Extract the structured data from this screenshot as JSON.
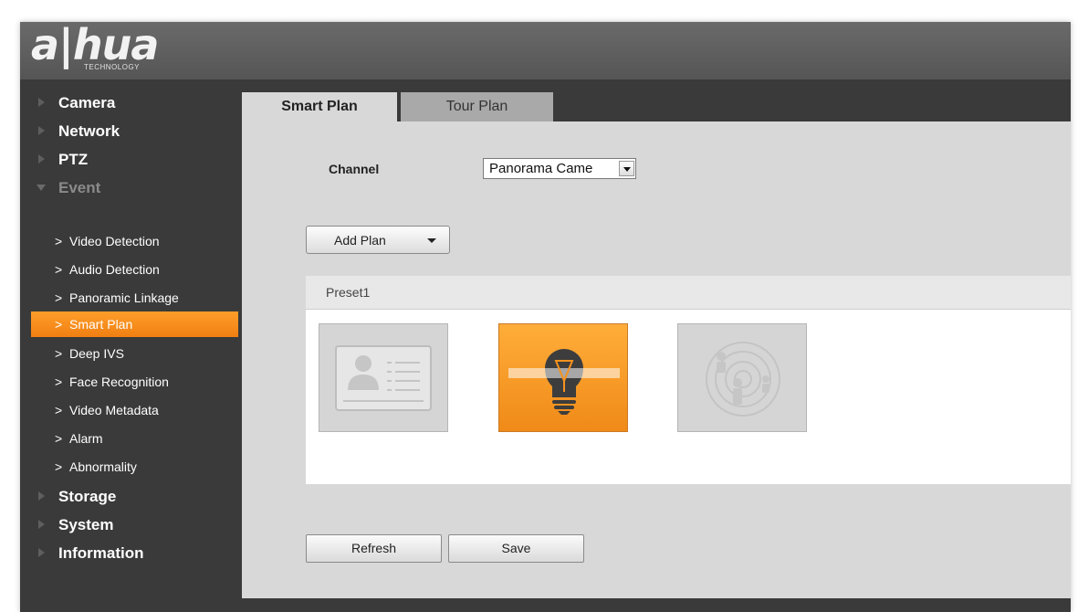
{
  "brand": {
    "logo_text": "a|hua",
    "logo_sub": "TECHNOLOGY"
  },
  "sidebar": {
    "main_before": [
      {
        "label": "Camera"
      },
      {
        "label": "Network"
      },
      {
        "label": "PTZ"
      },
      {
        "label": "Event"
      }
    ],
    "sub_items": [
      {
        "label": "Video Detection"
      },
      {
        "label": "Audio Detection"
      },
      {
        "label": "Panoramic Linkage"
      },
      {
        "label": "Smart Plan"
      },
      {
        "label": "Deep IVS"
      },
      {
        "label": "Face Recognition"
      },
      {
        "label": "Video Metadata"
      },
      {
        "label": "Alarm"
      },
      {
        "label": "Abnormality"
      }
    ],
    "main_after": [
      {
        "label": "Storage"
      },
      {
        "label": "System"
      },
      {
        "label": "Information"
      }
    ]
  },
  "tabs": [
    {
      "label": "Smart Plan"
    },
    {
      "label": "Tour Plan"
    }
  ],
  "form": {
    "channel_label": "Channel",
    "channel_value": "Panorama Came",
    "add_plan_label": "Add Plan"
  },
  "preset": {
    "title": "Preset1",
    "tiles": [
      {
        "icon": "face-card-icon",
        "state": "inactive"
      },
      {
        "icon": "lightbulb-icon",
        "state": "active"
      },
      {
        "icon": "people-radar-icon",
        "state": "inactive"
      }
    ]
  },
  "buttons": {
    "refresh": "Refresh",
    "save": "Save"
  },
  "colors": {
    "accent": "#f5921e",
    "sidebar_bg": "#3a3a3a",
    "panel_bg": "#d8d8d8"
  }
}
